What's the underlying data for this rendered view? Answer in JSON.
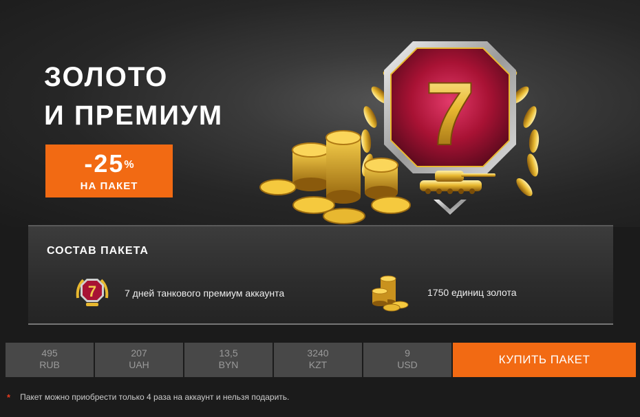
{
  "hero": {
    "title_line1": "ЗОЛОТО",
    "title_line2": "И ПРЕМИУМ",
    "badge_number": "7"
  },
  "discount": {
    "value": "-25",
    "percent_sign": "%",
    "subtitle": "НА ПАКЕТ"
  },
  "package": {
    "title": "СОСТАВ ПАКЕТА",
    "items": [
      {
        "icon": "premium-7-days-icon",
        "label": "7 дней танкового премиум аккаунта",
        "badge": "7"
      },
      {
        "icon": "gold-coins-icon",
        "label": "1750 единиц золота"
      }
    ]
  },
  "prices": [
    {
      "amount": "495",
      "currency": "RUB"
    },
    {
      "amount": "207",
      "currency": "UAH"
    },
    {
      "amount": "13,5",
      "currency": "BYN"
    },
    {
      "amount": "3240",
      "currency": "KZT"
    },
    {
      "amount": "9",
      "currency": "USD"
    }
  ],
  "buy_button": {
    "label": "КУПИТЬ ПАКЕТ"
  },
  "footnote": {
    "marker": "*",
    "text": "Пакет можно приобрести только 4 раза на аккаунт и нельзя подарить."
  },
  "colors": {
    "accent": "#f26a13",
    "gold": "#e8b830",
    "badge_red": "#b3123a"
  }
}
